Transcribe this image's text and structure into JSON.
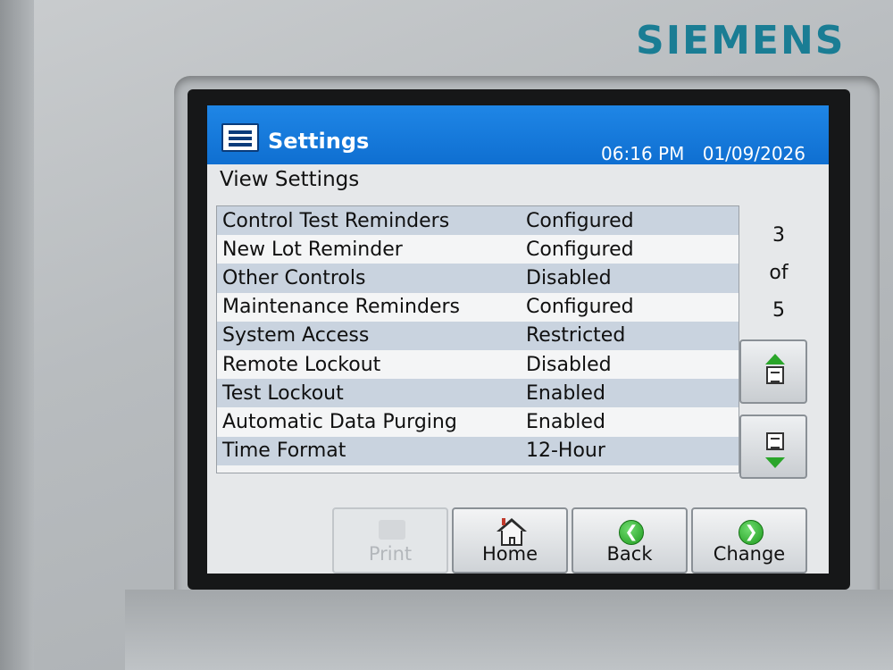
{
  "brand": "SIEMENS",
  "header": {
    "title": "Settings",
    "time": "06:16 PM",
    "date": "01/09/2026",
    "icon": "list-icon"
  },
  "subtitle": "View Settings",
  "settings": [
    {
      "name": "Control Test Reminders",
      "value": "Configured"
    },
    {
      "name": "New Lot Reminder",
      "value": "Configured"
    },
    {
      "name": "Other Controls",
      "value": "Disabled"
    },
    {
      "name": "Maintenance Reminders",
      "value": "Configured"
    },
    {
      "name": "System Access",
      "value": "Restricted"
    },
    {
      "name": "Remote Lockout",
      "value": "Disabled"
    },
    {
      "name": "Test Lockout",
      "value": "Enabled"
    },
    {
      "name": "Automatic Data Purging",
      "value": "Enabled"
    },
    {
      "name": "Time Format",
      "value": "12-Hour"
    }
  ],
  "pager": {
    "current": "3",
    "of_label": "of",
    "total": "5"
  },
  "buttons": {
    "print": "Print",
    "home": "Home",
    "back": "Back",
    "change": "Change"
  },
  "icons": {
    "page_up": "page-up-icon",
    "page_down": "page-down-icon",
    "print": "printer-icon",
    "home": "home-icon",
    "back": "back-arrow-icon",
    "change": "forward-arrow-icon"
  },
  "colors": {
    "titlebar": "#1f86e6",
    "brand": "#1a7d94",
    "row_alt": "#c9d3df",
    "arrow_green": "#2aa52a"
  }
}
